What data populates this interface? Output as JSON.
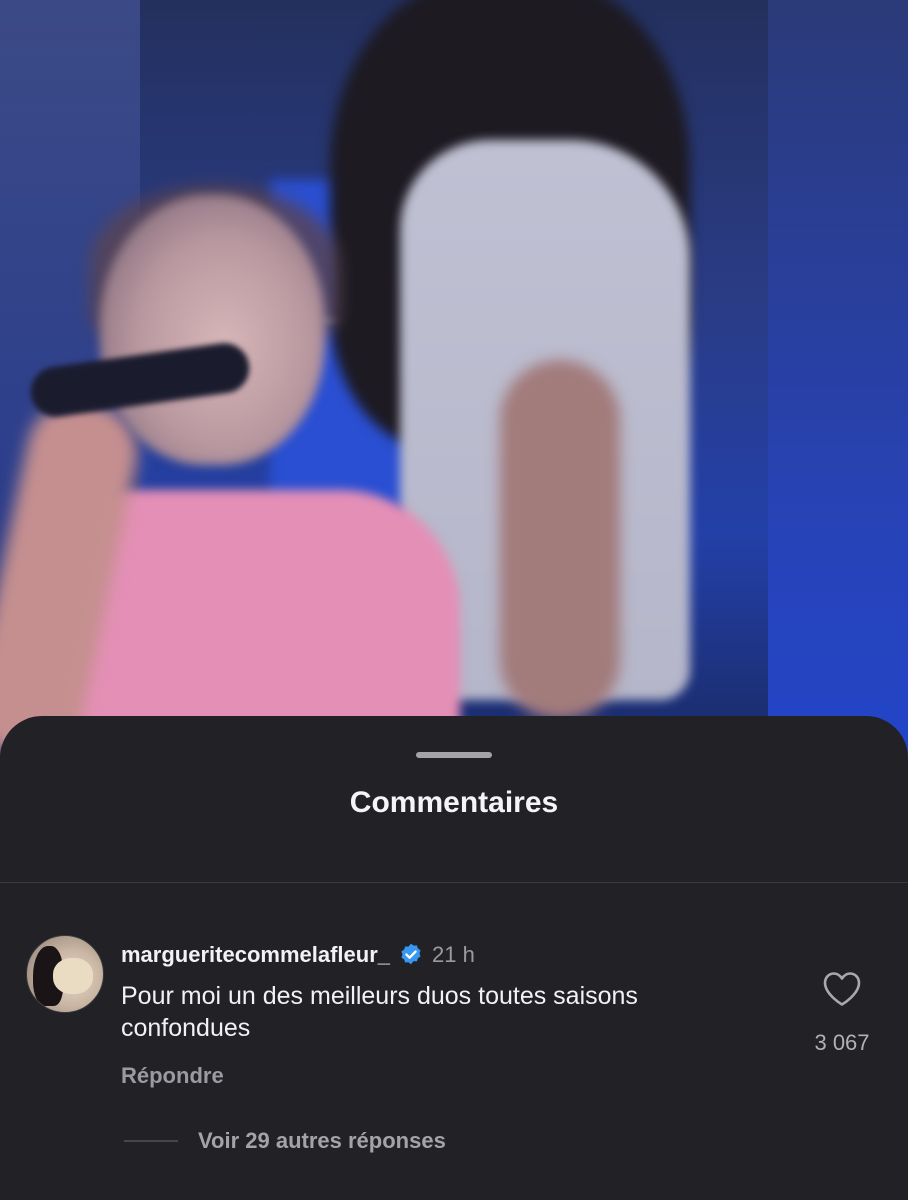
{
  "sheet": {
    "title": "Commentaires"
  },
  "comment": {
    "username": "margueritecommelafleur_",
    "verified": true,
    "time": "21 h",
    "text": "Pour moi un des meilleurs duos toutes saisons confondues",
    "reply_label": "Répondre",
    "like_count": "3 067"
  },
  "replies": {
    "label": "Voir 29 autres réponses"
  },
  "colors": {
    "sheet_bg": "#222226",
    "verified": "#3897f0",
    "secondary_text": "#9a9aa0"
  },
  "icons": {
    "like": "heart-outline-icon",
    "verified": "verified-badge-icon"
  }
}
